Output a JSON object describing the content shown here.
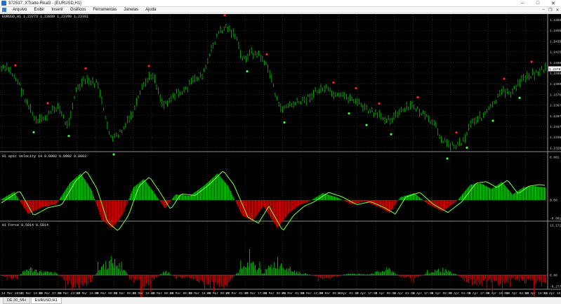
{
  "window": {
    "title": "372537: XTrade-Real3 - [EURUSD,H1]",
    "minimize_glyph": "–",
    "maximize_glyph": "□",
    "close_glyph": "✕"
  },
  "menu": {
    "items": [
      "Arquivo",
      "Exibir",
      "Inserir",
      "Gráficos",
      "Ferramentas",
      "Janelas",
      "Ajuda"
    ],
    "mdi_min": "–",
    "mdi_restore": "❐",
    "mdi_close": "✕"
  },
  "colors": {
    "background": "#000000",
    "candle": "#00b400",
    "grid": "#4a4a4a",
    "positive": "#00c800",
    "negative": "#e00000",
    "signal_line": "#7cff3c",
    "dot_red": "#ff2020",
    "dot_green": "#3cff3c",
    "price_box": "#ffffff"
  },
  "panes": {
    "main": {
      "label": "EURUSD,H1  1.23773 1.23839 1.23709 1.23781",
      "price_ticks": [
        "1.24650",
        "1.24555",
        "1.24355",
        "1.24255",
        "1.24060",
        "1.23965",
        "1.23865",
        "1.23765",
        "1.23670",
        "1.23575",
        "1.23475",
        "1.23380",
        "1.23280"
      ],
      "current_price": "1.23781"
    },
    "velocity": {
      "label": "H1  epic velocity 14 0.0002 0.0002 0.0003",
      "ticks": [
        "0.001",
        "0.00",
        "-0.0011"
      ]
    },
    "force": {
      "label": "H1  Force 0.5814 0.5814",
      "ticks": [
        "13.1725",
        "0.00",
        "-6.2772"
      ]
    }
  },
  "time_axis": [
    "14 Mar 2018",
    "15 Mar 19:00",
    "16 Mar 07:00",
    "16 Mar 23:00",
    "19 Mar 16:00",
    "20 Mar 08:00",
    "21 Mar 00:00",
    "21 Mar 16:00",
    "22 Mar 08:00",
    "23 Mar 00:00",
    "23 Mar 16:00",
    "26 Mar 09:00",
    "27 Mar 01:00",
    "27 Mar 17:00",
    "28 Mar 09:00",
    "29 Mar 01:00",
    "29 Mar 17:00",
    "30 Mar 09:00",
    "2 Apr 01:00",
    "2 Apr 17:00",
    "3 Apr 09:00",
    "4 Apr 01:00",
    "4 Apr 17:00",
    "5 Apr 09:00",
    "6 Apr 01:00",
    "6 Apr 17:00",
    "9 Apr 10:00",
    "10 Apr 02:00",
    "10 Apr 18:00",
    "11 Apr 10:00"
  ],
  "tabs": [
    "DE.30_MH",
    "EURUSD,H1"
  ],
  "active_tab": 1
}
